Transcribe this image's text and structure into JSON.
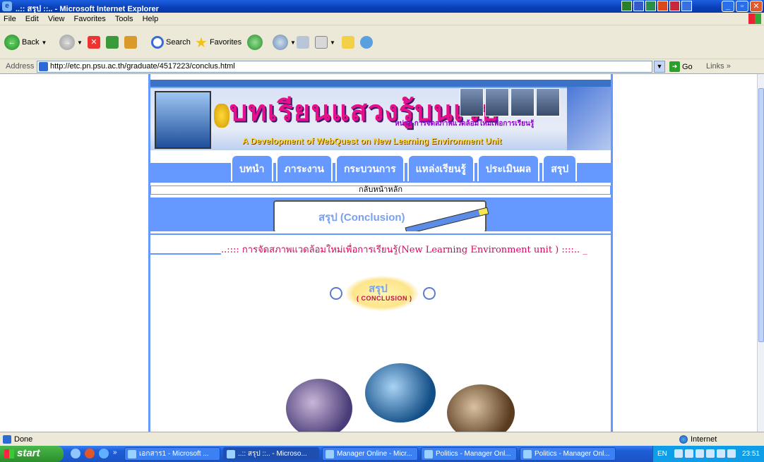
{
  "window": {
    "title": "..:: สรุป ::.. - Microsoft Internet Explorer"
  },
  "menu": [
    "File",
    "Edit",
    "View",
    "Favorites",
    "Tools",
    "Help"
  ],
  "toolbar": {
    "back_label": "Back",
    "search_label": "Search",
    "favorites_label": "Favorites"
  },
  "address": {
    "label": "Address",
    "url": "http://etc.pn.psu.ac.th/graduate/4517223/conclus.html",
    "go_label": "Go",
    "links_label": "Links"
  },
  "page": {
    "banner_title": "บทเรียนแสวงรู้บนเว็บ",
    "banner_subtitle": "หน่วย การจัดสภาพแวดล้อมใหม่เพื่อการเรียนรู้",
    "banner_english": "A Development of WebQuest on New Learning Environment Unit",
    "nav_tabs": [
      "บทนำ",
      "ภาระงาน",
      "กระบวนการ",
      "แหล่งเรียนรู้",
      "ประเมินผล",
      "สรุป"
    ],
    "home_link": "กลับหน้าหลัก",
    "section_title": "สรุป (Conclusion)",
    "marquee": "..:::: การจัดสภาพแวดล้อมใหม่เพื่อการเรียนรู้(New Learning Environment unit ) ::::.. _",
    "badge_thai": "สรุป",
    "badge_english": "( CONCLUSION )"
  },
  "status": {
    "left": "Done",
    "zone": "Internet"
  },
  "taskbar": {
    "start_label": "start",
    "tasks": [
      "เอกสาร1 - Microsoft ...",
      "..:: สรุป ::.. - Microso...",
      "Manager Online - Micr...",
      "Politics - Manager Onl...",
      "Politics - Manager Onl..."
    ],
    "lang": "EN",
    "clock": "23:51"
  },
  "colors": {
    "page_blue": "#6699ff",
    "title_pink": "#e6108a",
    "marquee_red": "#e00060"
  }
}
